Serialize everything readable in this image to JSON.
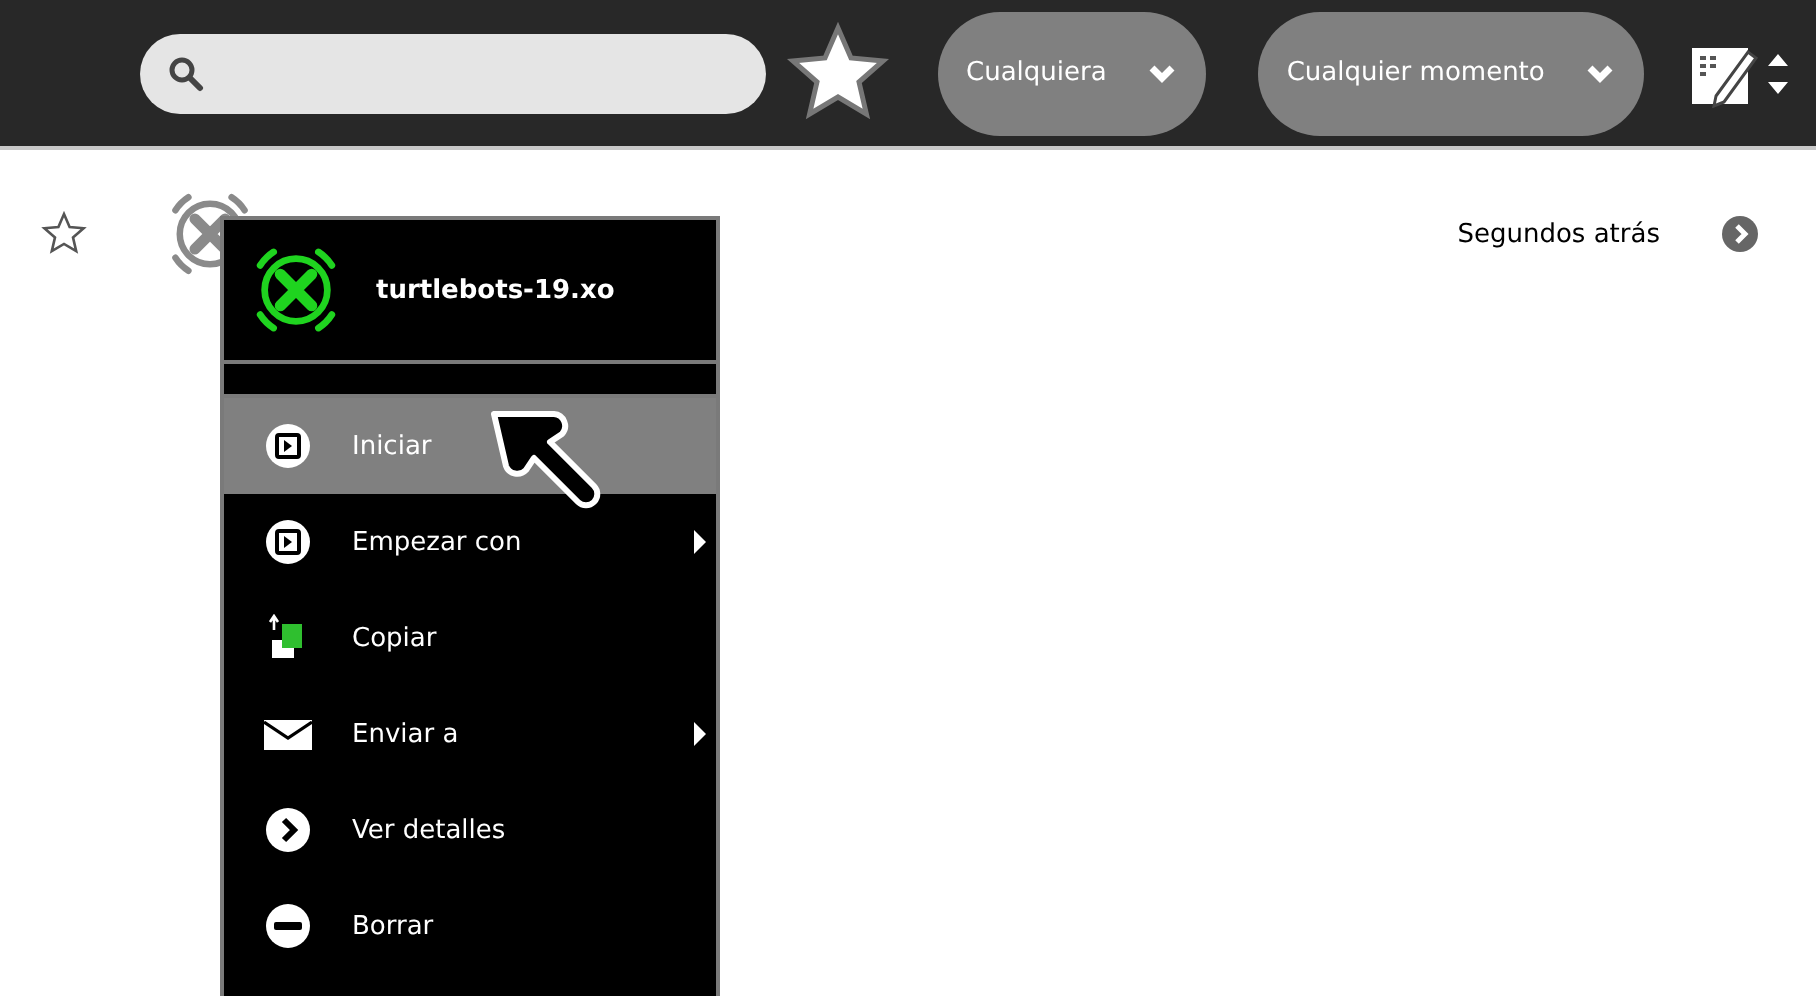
{
  "toolbar": {
    "filters": [
      {
        "label": "Cualquiera"
      },
      {
        "label": "Cualquier momento"
      }
    ]
  },
  "entries": [
    {
      "starred": false,
      "time": "Segundos atrás"
    }
  ],
  "palette": {
    "title": "turtlebots-19.xo",
    "items": [
      {
        "label": "Iniciar",
        "selected": true,
        "submenu": false
      },
      {
        "label": "Empezar con",
        "selected": false,
        "submenu": true
      },
      {
        "label": "Copiar",
        "selected": false,
        "submenu": false
      },
      {
        "label": "Enviar a",
        "selected": false,
        "submenu": true
      },
      {
        "label": "Ver detalles",
        "selected": false,
        "submenu": false
      },
      {
        "label": "Borrar",
        "selected": false,
        "submenu": false
      }
    ]
  }
}
